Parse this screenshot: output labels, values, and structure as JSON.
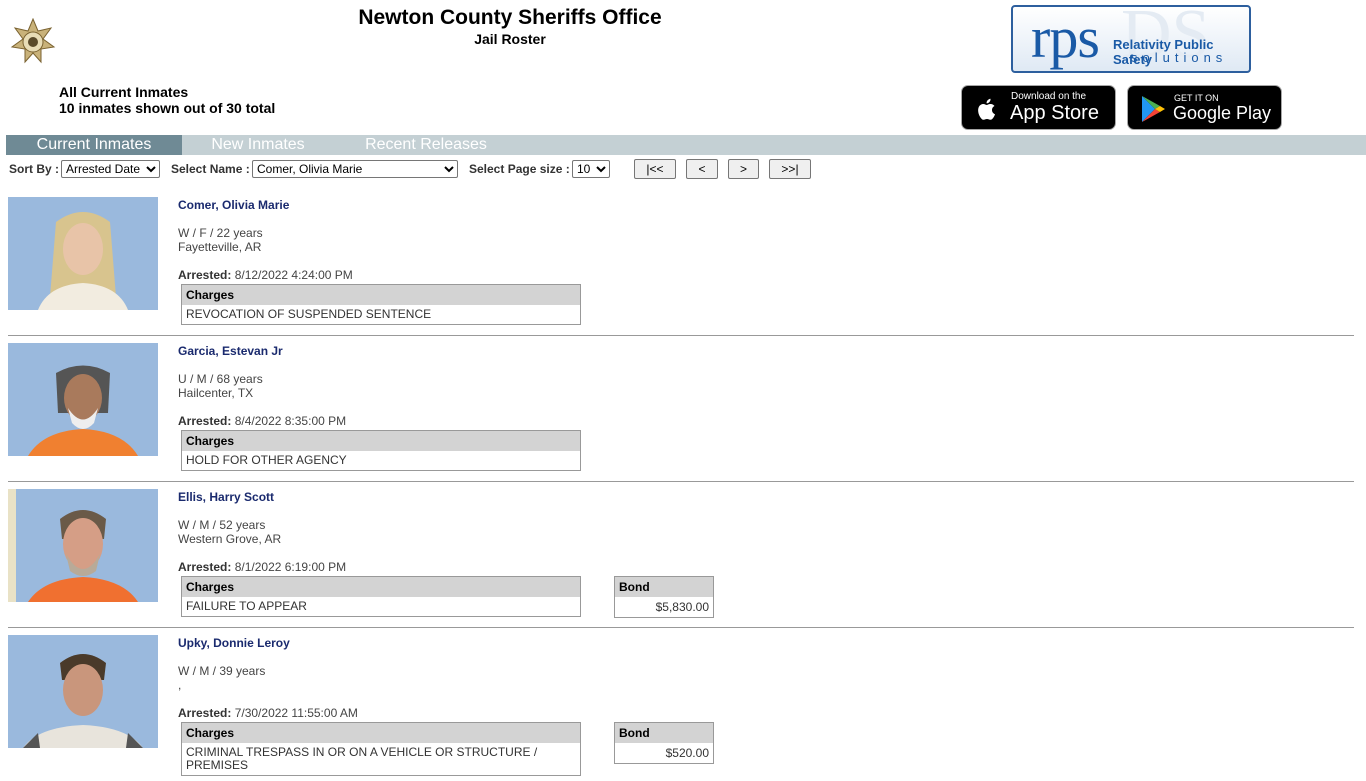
{
  "header": {
    "title": "Newton County Sheriffs Office",
    "subtitle": "Jail Roster",
    "list_title": "All Current Inmates",
    "count_text": "10 inmates shown out of 30 total"
  },
  "logo": {
    "mark": "rps",
    "line1": "Relativity Public Safety",
    "line2": "solutions"
  },
  "stores": {
    "apple_small": "Download on the",
    "apple_big": "App Store",
    "google_small": "GET IT ON",
    "google_big": "Google Play"
  },
  "tabs": [
    {
      "label": "Current Inmates"
    },
    {
      "label": "New Inmates"
    },
    {
      "label": "Recent Releases"
    }
  ],
  "controls": {
    "sort_label": "Sort By :",
    "sort_value": "Arrested Date",
    "name_label": "Select Name :",
    "name_value": "Comer, Olivia Marie",
    "pagesize_label": "Select Page size :",
    "pagesize_value": "10",
    "first": "|<<",
    "prev": "<",
    "next": ">",
    "last": ">>|"
  },
  "inmates": [
    {
      "name": "Comer, Olivia Marie",
      "demo": "W / F / 22 years",
      "location": "Fayetteville, AR",
      "arrested_label": "Arrested:",
      "arrested": "8/12/2022 4:24:00 PM",
      "charges_header": "Charges",
      "charge": "REVOCATION OF SUSPENDED SENTENCE",
      "bond_header": "",
      "bond": ""
    },
    {
      "name": "Garcia, Estevan Jr",
      "demo": "U / M / 68 years",
      "location": "Hailcenter, TX",
      "arrested_label": "Arrested:",
      "arrested": "8/4/2022 8:35:00 PM",
      "charges_header": "Charges",
      "charge": "HOLD FOR OTHER AGENCY",
      "bond_header": "",
      "bond": ""
    },
    {
      "name": "Ellis, Harry Scott",
      "demo": "W / M / 52 years",
      "location": "Western Grove, AR",
      "arrested_label": "Arrested:",
      "arrested": "8/1/2022 6:19:00 PM",
      "charges_header": "Charges",
      "charge": "FAILURE TO APPEAR",
      "bond_header": "Bond",
      "bond": "$5,830.00"
    },
    {
      "name": "Upky, Donnie Leroy",
      "demo": "W / M / 39 years",
      "location": ",",
      "arrested_label": "Arrested:",
      "arrested": "7/30/2022 11:55:00 AM",
      "charges_header": "Charges",
      "charge": "CRIMINAL TRESPASS IN OR ON A VEHICLE OR STRUCTURE / PREMISES",
      "bond_header": "Bond",
      "bond": "$520.00"
    }
  ]
}
